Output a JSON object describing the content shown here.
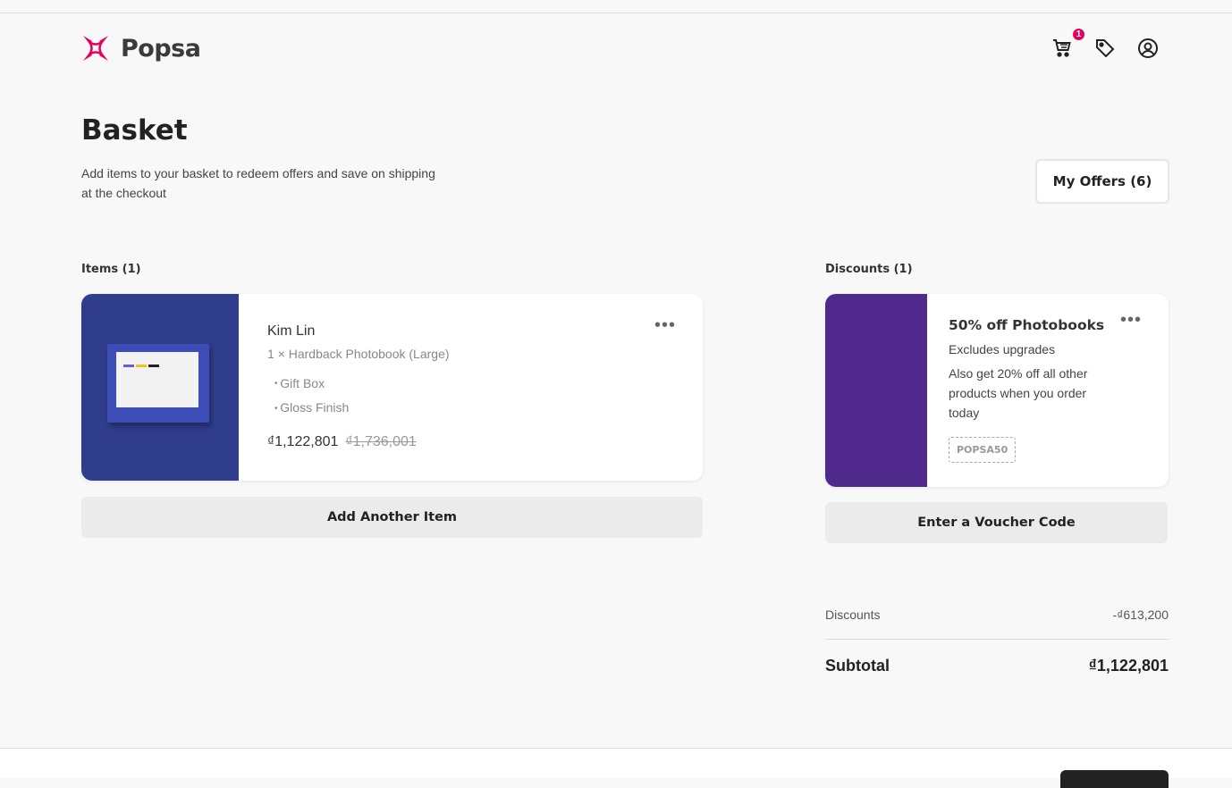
{
  "brand": {
    "name": "Popsa",
    "accent": "#e6005c"
  },
  "header": {
    "cart_count": "1",
    "icons": [
      "cart-icon",
      "tag-icon",
      "account-icon"
    ]
  },
  "page": {
    "title": "Basket",
    "subtitle": "Add items to your basket to redeem offers and save on shipping at the checkout",
    "offers_button": "My Offers (6)"
  },
  "items": {
    "label": "Items (1)",
    "list": [
      {
        "name": "Kim Lin",
        "product": "1 × Hardback Photobook (Large)",
        "options": [
          "Gift Box",
          "Gloss Finish"
        ],
        "price": "₫1,122,801",
        "original_price": "₫1,736,001",
        "thumb_color": "#2f3d8c"
      }
    ],
    "add_button": "Add Another Item"
  },
  "discounts": {
    "label": "Discounts (1)",
    "list": [
      {
        "title": "50% off Photobooks",
        "subtitle": "Excludes upgrades",
        "description": "Also get 20% off all other products when you order today",
        "code": "POPSA50",
        "color": "#4f2a8c"
      }
    ],
    "voucher_button": "Enter a Voucher Code"
  },
  "summary": {
    "discounts_label": "Discounts",
    "discounts_value": "-₫613,200",
    "subtotal_label": "Subtotal",
    "subtotal_value": "₫1,122,801"
  }
}
